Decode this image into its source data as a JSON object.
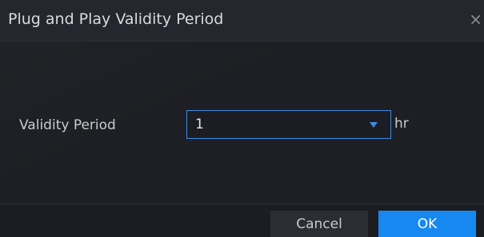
{
  "dialog": {
    "title": "Plug and Play Validity Period",
    "close_icon": "close-icon",
    "close_glyph": "×"
  },
  "form": {
    "validity_label": "Validity Period",
    "validity_value": "1",
    "unit": "hr"
  },
  "footer": {
    "cancel_label": "Cancel",
    "ok_label": "OK"
  },
  "colors": {
    "accent": "#1688f0",
    "background": "#1e2025"
  }
}
